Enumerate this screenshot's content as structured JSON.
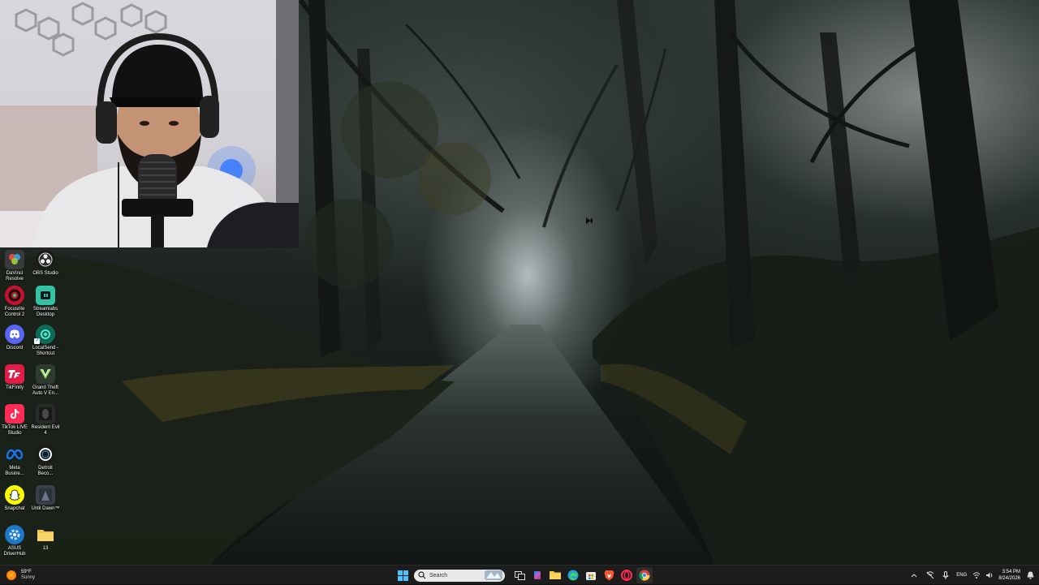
{
  "desktop": {
    "icons": [
      {
        "label": "DaVinci Resolve",
        "icon": "davinci-resolve-icon",
        "color": "#3a3a3a"
      },
      {
        "label": "OBS Studio",
        "icon": "obs-studio-icon",
        "color": "#1a1a1a"
      },
      {
        "label": "Focusrite Control 2",
        "icon": "focusrite-control-icon",
        "color": "#c8102e"
      },
      {
        "label": "Streamlabs Desktop",
        "icon": "streamlabs-icon",
        "color": "#31c3a2"
      },
      {
        "label": "Discord",
        "icon": "discord-icon",
        "color": "#5865f2"
      },
      {
        "label": "LocalSend - Shortcut",
        "icon": "localsend-icon",
        "color": "#0f6a5a"
      },
      {
        "label": "TikFinity",
        "icon": "tikfinity-icon",
        "color": "#e11d48"
      },
      {
        "label": "Grand Theft Auto V En...",
        "icon": "gta-v-icon",
        "color": "#2f3a2f"
      },
      {
        "label": "TikTok LIVE Studio",
        "icon": "tiktok-live-studio-icon",
        "color": "#ff2d55"
      },
      {
        "label": "Resident Evil 4",
        "icon": "resident-evil-4-icon",
        "color": "#2b2b2b"
      },
      {
        "label": "Meta Busine...",
        "icon": "meta-business-icon",
        "color": "#0866ff"
      },
      {
        "label": "Detroit Beco...",
        "icon": "detroit-become-human-icon",
        "color": "#1b1b1b"
      },
      {
        "label": "Snapchat",
        "icon": "snapchat-icon",
        "color": "#fffc00"
      },
      {
        "label": "Until Dawn™",
        "icon": "until-dawn-icon",
        "color": "#3a4048"
      },
      {
        "label": "ASUS DriverHub",
        "icon": "asus-driverhub-icon",
        "color": "#1e78c8"
      },
      {
        "label": "13",
        "icon": "folder-icon",
        "color": "#f4c542"
      }
    ]
  },
  "taskbar": {
    "weather": {
      "temp": "59°F",
      "condition": "Sunny"
    },
    "search_placeholder": "Search",
    "pinned": [
      "windows-start-icon",
      "task-view-icon",
      "copilot-icon",
      "file-explorer-icon",
      "edge-icon",
      "microsoft-store-icon",
      "brave-icon",
      "opera-gx-icon",
      "chrome-icon"
    ],
    "tray": {
      "language": "ENG",
      "time": "3:54 PM",
      "date": "8/24/2026"
    }
  }
}
